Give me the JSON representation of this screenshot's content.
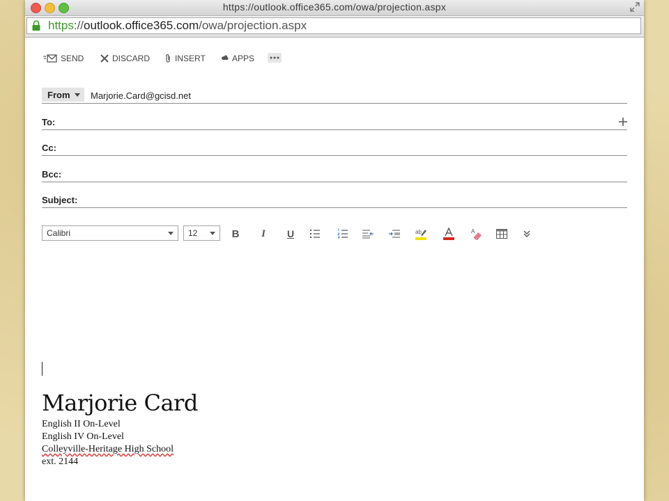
{
  "browser": {
    "title": "https://outlook.office365.com/owa/projection.aspx",
    "url_scheme": "https",
    "url_separator": "://",
    "url_host": "outlook.office365.com",
    "url_path": "/owa/projection.aspx"
  },
  "toolbar": {
    "send_label": "SEND",
    "discard_label": "DISCARD",
    "insert_label": "INSERT",
    "apps_label": "APPS"
  },
  "compose": {
    "from_label": "From",
    "from_value": "Marjorie.Card@gcisd.net",
    "to_label": "To:",
    "cc_label": "Cc:",
    "bcc_label": "Bcc:",
    "subject_label": "Subject:"
  },
  "format": {
    "font_family": "Calibri",
    "font_size": "12",
    "bold_label": "B",
    "italic_label": "I",
    "underline_label": "U"
  },
  "signature": {
    "name": "Marjorie Card",
    "line1": "English II On-Level",
    "line2": "English IV On-Level",
    "line3": "Colleyville-Heritage High School",
    "line4": "ext. 2144"
  },
  "colors": {
    "https_green": "#3c9a2a",
    "highlight_yellow": "#f5e000",
    "font_color_red": "#d9261c"
  }
}
